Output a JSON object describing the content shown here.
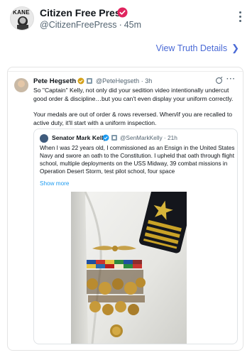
{
  "header": {
    "avatar_text": "KANE",
    "display_name": "Citizen Free Press",
    "handle": "@CitizenFreePress",
    "separator": "·",
    "time": "45m",
    "verified_icon": "verified-badge-icon",
    "more_icon": "more-vertical-icon"
  },
  "view_details": {
    "label": "View Truth Details",
    "icon": "chevron-right-icon",
    "color": "#4a6ad6"
  },
  "embedded_post": {
    "author": "Pete Hegseth",
    "handle": "@PeteHegseth",
    "separator": "·",
    "time": "3h",
    "more": "···",
    "paragraph1": "So \"Captain\" Kelly, not only did your sedition video intentionally undercut good order & discipline…but you can't even display your uniform correctly.",
    "paragraph2": "Your medals are out of order & rows reversed. When/if you are recalled to active duty, it'll start with a uniform inspection.",
    "quote": {
      "author": "Senator Mark Kelly",
      "handle": "@SenMarkKelly",
      "separator": "·",
      "time": "21h",
      "text": "When I was 22 years old, I commissioned as an Ensign in the United States Navy and swore an oath to the Constitution. I upheld that oath through flight school, multiple deployments on the USS Midway, 39 combat missions in Operation Desert Storm, test pilot school, four space",
      "show_more": "Show more"
    }
  },
  "colors": {
    "link_blue": "#1d9bf0",
    "verified_pink": "#e0245e",
    "verified_gold": "#d4a017",
    "gov_gray": "#829aab",
    "text_secondary": "#536471"
  }
}
